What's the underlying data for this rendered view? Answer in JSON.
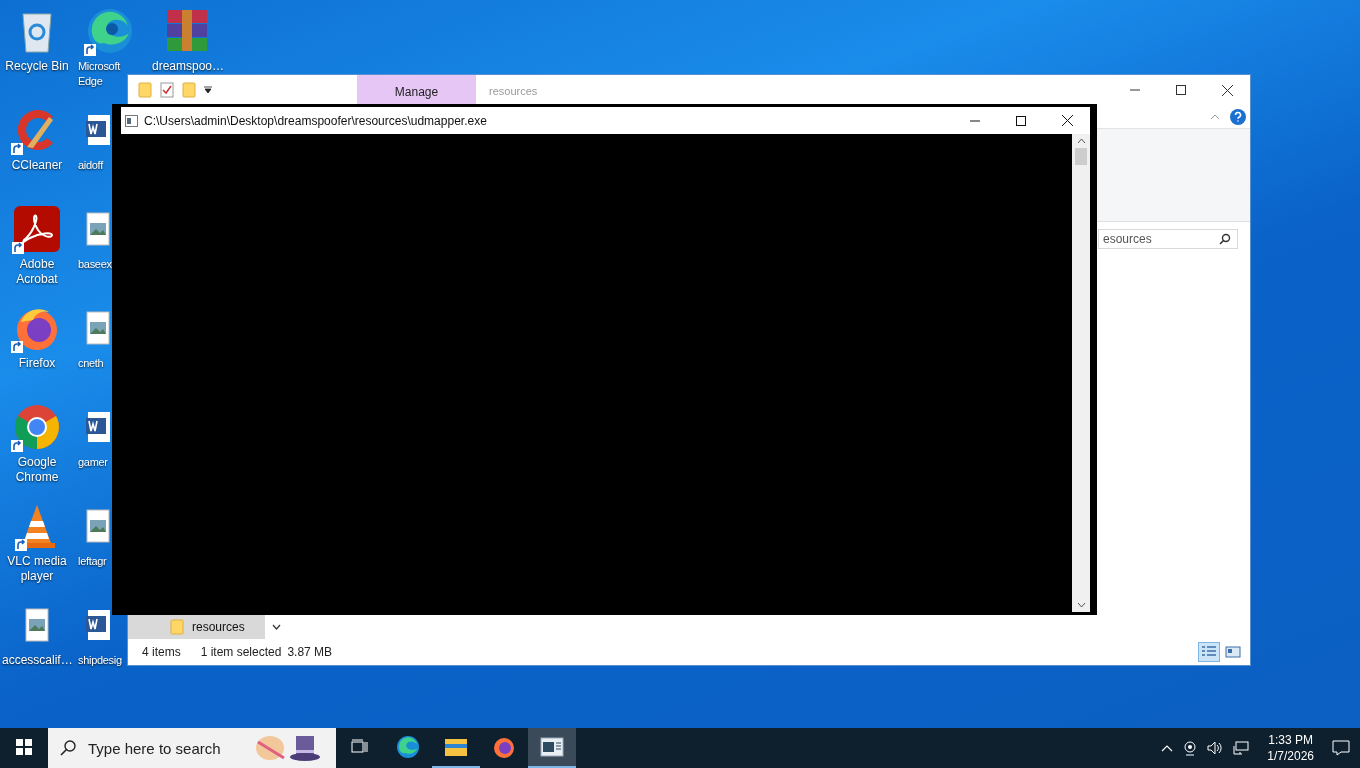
{
  "desktop": {
    "columns": [
      [
        {
          "label": "Recycle Bin",
          "kind": "recycle",
          "shortcut": false
        },
        {
          "label": "CCleaner",
          "kind": "ccleaner",
          "shortcut": true
        },
        {
          "label": "Adobe Acrobat",
          "kind": "acrobat",
          "shortcut": true
        },
        {
          "label": "Firefox",
          "kind": "firefox",
          "shortcut": true
        },
        {
          "label": "Google Chrome",
          "kind": "chrome",
          "shortcut": true
        },
        {
          "label": "VLC media player",
          "kind": "vlc",
          "shortcut": true
        },
        {
          "label": "accesscalif…",
          "kind": "image",
          "shortcut": false
        }
      ],
      [
        {
          "label": "Microsoft Edge",
          "kind": "edge",
          "shortcut": true
        },
        {
          "label": "aidoff",
          "kind": "word",
          "shortcut": false
        },
        {
          "label": "baseex",
          "kind": "image",
          "shortcut": false
        },
        {
          "label": "cneth",
          "kind": "image",
          "shortcut": false
        },
        {
          "label": "gamer",
          "kind": "word",
          "shortcut": false
        },
        {
          "label": "leftagr",
          "kind": "image",
          "shortcut": false
        },
        {
          "label": "shipdesig",
          "kind": "word",
          "shortcut": false
        }
      ],
      [
        {
          "label": "dreamspoo…",
          "kind": "winrar",
          "shortcut": false
        }
      ]
    ]
  },
  "explorer": {
    "tabs": [
      {
        "label": "Manage",
        "selected": true
      }
    ],
    "title": "resources",
    "search": {
      "placeholder": "esources"
    },
    "nav_items": [
      {
        "label": "resources",
        "selected": true
      }
    ],
    "status_bar": {
      "item_count": "4 items",
      "selection": "1 item selected",
      "size": "3.87 MB"
    },
    "views": [
      {
        "kind": "details",
        "selected": true
      },
      {
        "kind": "tiles",
        "selected": false
      }
    ]
  },
  "console": {
    "title": "C:\\Users\\admin\\Desktop\\dreamspoofer\\resources\\udmapper.exe"
  },
  "taskbar": {
    "search_placeholder": "Type here to search",
    "apps": [
      {
        "kind": "taskview",
        "running": false,
        "active": false
      },
      {
        "kind": "edge",
        "running": false,
        "active": false
      },
      {
        "kind": "explorer",
        "running": true,
        "active": false
      },
      {
        "kind": "firefox",
        "running": false,
        "active": false
      },
      {
        "kind": "console",
        "running": true,
        "active": true
      }
    ],
    "clock": {
      "time": "1:33 PM",
      "date": "1/7/2026"
    }
  }
}
